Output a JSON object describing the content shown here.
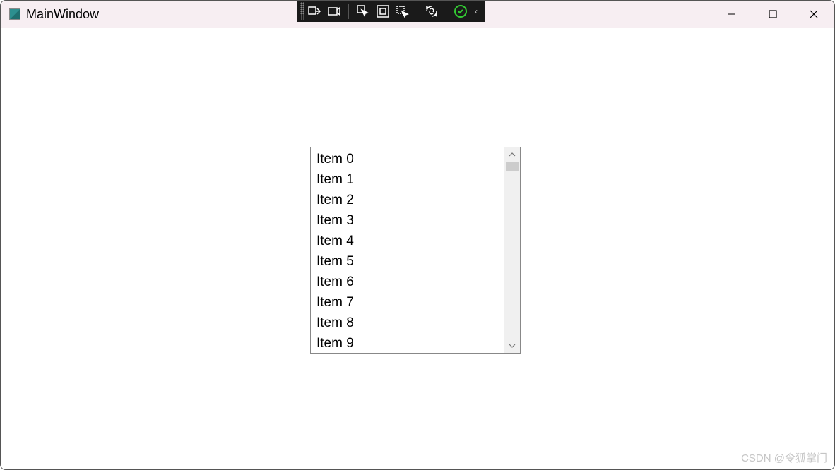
{
  "window": {
    "title": "MainWindow"
  },
  "listbox": {
    "items": [
      "Item 0",
      "Item 1",
      "Item 2",
      "Item 3",
      "Item 4",
      "Item 5",
      "Item 6",
      "Item 7",
      "Item 8",
      "Item 9"
    ]
  },
  "watermark": "CSDN @令狐掌门"
}
